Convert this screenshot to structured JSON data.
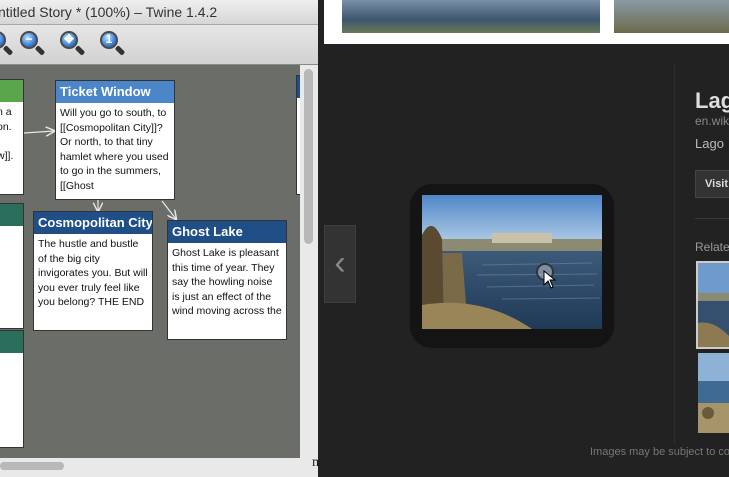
{
  "twine": {
    "window_title": "ntitled Story * (100%) – Twine 1.4.2",
    "toolbar": [
      {
        "icon": "zoom-out-icon",
        "glyph": "−"
      },
      {
        "icon": "zoom-fit-icon",
        "glyph": "✥"
      },
      {
        "icon": "zoom-actual-icon",
        "glyph": "1"
      }
    ],
    "passages": [
      {
        "title": "Ticket Window",
        "head_color": "#4a86c8",
        "text": "Will you go to south, to [[Cosmopolitan City]]? Or north, to that tiny hamlet where you used to go in the summers, [[Ghost"
      },
      {
        "title": "Cosmopolitan City",
        "head_color": "#1f4f86",
        "text": "The hustle and bustle of the big city invigorates you. But will you ever truly feel like you belong? THE END"
      },
      {
        "title": "Ghost Lake",
        "head_color": "#1f4f86",
        "text": "Ghost Lake is pleasant this time of year. They say the howling noise is just an effect of the wind moving across the"
      }
    ],
    "partial_passage_text": "n a\non.\n\nw]].",
    "edge_text": "m"
  },
  "viewer": {
    "title": "Lag",
    "source_url": "en.wik",
    "subtitle": "Lago",
    "visit_button": "Visit",
    "related_label": "Relate",
    "disclaimer": "Images may be subject to co",
    "prev_glyph": "‹"
  }
}
